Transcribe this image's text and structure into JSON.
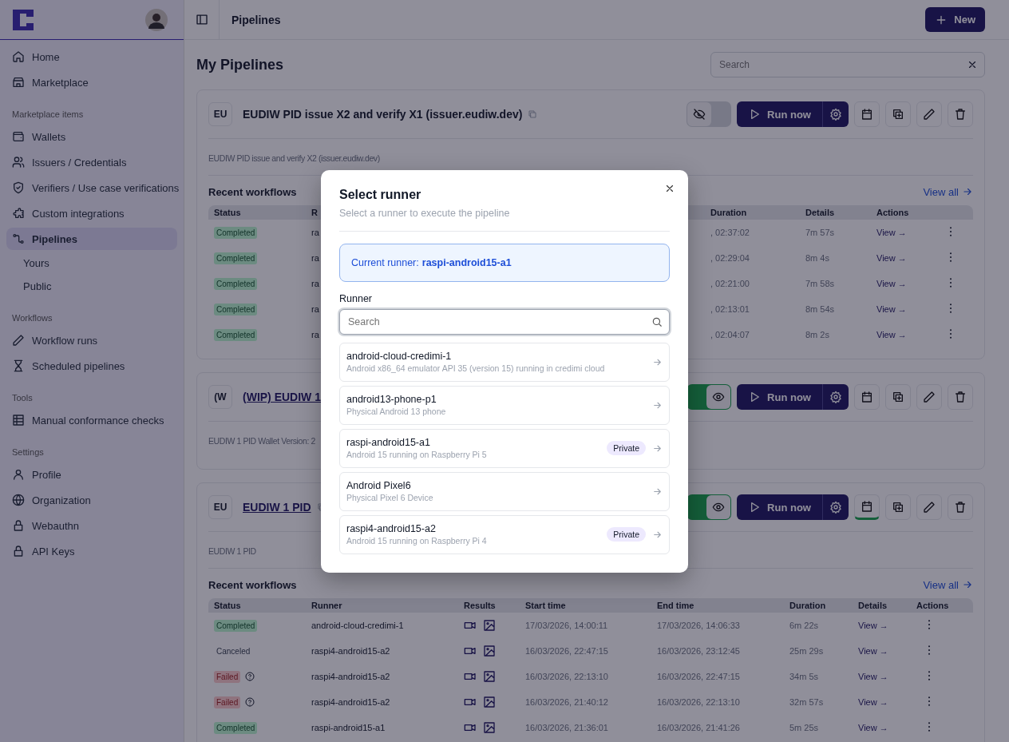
{
  "sidebar": {
    "groups": [
      {
        "items": [
          {
            "label": "Home",
            "selected": false
          },
          {
            "label": "Marketplace",
            "selected": false
          }
        ]
      },
      {
        "heading": "Marketplace items",
        "items": [
          {
            "label": "Wallets",
            "selected": false
          },
          {
            "label": "Issuers / Credentials",
            "selected": false
          },
          {
            "label": "Verifiers / Use case verifications",
            "selected": false
          },
          {
            "label": "Custom integrations",
            "selected": false
          },
          {
            "label": "Pipelines",
            "selected": true,
            "children": [
              {
                "label": "Yours",
                "selected": false
              },
              {
                "label": "Public",
                "selected": false
              }
            ]
          }
        ]
      },
      {
        "heading": "Workflows",
        "items": [
          {
            "label": "Workflow runs",
            "selected": false
          },
          {
            "label": "Scheduled pipelines",
            "selected": false
          }
        ]
      },
      {
        "heading": "Tools",
        "items": [
          {
            "label": "Manual conformance checks",
            "selected": false
          }
        ]
      },
      {
        "heading": "Settings",
        "items": [
          {
            "label": "Profile",
            "selected": false
          },
          {
            "label": "Organization",
            "selected": false
          },
          {
            "label": "Webauthn",
            "selected": false
          },
          {
            "label": "API Keys",
            "selected": false
          }
        ]
      }
    ]
  },
  "header": {
    "title": "Pipelines",
    "new_button": "New"
  },
  "page_title": "My Pipelines",
  "search": {
    "placeholder": "Search"
  },
  "pipelines": [
    {
      "badge": "EU",
      "title": "EUDIW PID issue X2 and verify X1 (issuer.eudiw.dev)",
      "link": false,
      "copy_icon": true,
      "public": false,
      "scheduled": false,
      "run_label": "Run now",
      "description": "EUDIW PID issue and verify X2 (issuer.eudiw.dev)",
      "workflows": {
        "heading": "Recent workflows",
        "view_all": "View all",
        "columns": {
          "status": "Status",
          "runner": "R",
          "duration": "Duration",
          "details": "Details",
          "actions": "Actions"
        },
        "rows": [
          {
            "status": "Completed",
            "kind": "completed",
            "runner": "ra",
            "end_time": ", 02:37:02",
            "duration": "7m 57s",
            "details": "View →"
          },
          {
            "status": "Completed",
            "kind": "completed",
            "runner": "ra",
            "end_time": ", 02:29:04",
            "duration": "8m 4s",
            "details": "View →"
          },
          {
            "status": "Completed",
            "kind": "completed",
            "runner": "ra",
            "end_time": ", 02:21:00",
            "duration": "7m 58s",
            "details": "View →"
          },
          {
            "status": "Completed",
            "kind": "completed",
            "runner": "ra",
            "end_time": ", 02:13:01",
            "duration": "8m 54s",
            "details": "View →"
          },
          {
            "status": "Completed",
            "kind": "completed",
            "runner": "ra",
            "end_time": ", 02:04:07",
            "duration": "8m 2s",
            "details": "View →"
          }
        ]
      }
    },
    {
      "badge": "(W",
      "title": "(WIP) EUDIW 1",
      "link": true,
      "copy_icon": false,
      "public": true,
      "scheduled": false,
      "run_label": "Run now",
      "description": "EUDIW 1 PID Wallet Version: 2"
    },
    {
      "badge": "EU",
      "title": "EUDIW 1 PID",
      "link": true,
      "copy_icon": true,
      "public": true,
      "scheduled": true,
      "run_label": "Run now",
      "description": "EUDIW 1 PID",
      "workflows": {
        "heading": "Recent workflows",
        "view_all": "View all",
        "columns": {
          "status": "Status",
          "runner": "Runner",
          "results": "Results",
          "start_time": "Start time",
          "end_time": "End time",
          "duration": "Duration",
          "details": "Details",
          "actions": "Actions"
        },
        "rows": [
          {
            "status": "Completed",
            "kind": "completed",
            "runner": "android-cloud-credimi-1",
            "start_time": "17/03/2026, 14:00:11",
            "end_time": "17/03/2026, 14:06:33",
            "duration": "6m 22s",
            "details": "View →"
          },
          {
            "status": "Canceled",
            "kind": "canceled",
            "runner": "raspi4-android15-a2",
            "start_time": "16/03/2026, 22:47:15",
            "end_time": "16/03/2026, 23:12:45",
            "duration": "25m 29s",
            "details": "View →"
          },
          {
            "status": "Failed",
            "kind": "failed",
            "runner": "raspi4-android15-a2",
            "start_time": "16/03/2026, 22:13:10",
            "end_time": "16/03/2026, 22:47:15",
            "duration": "34m 5s",
            "details": "View →"
          },
          {
            "status": "Failed",
            "kind": "failed",
            "runner": "raspi4-android15-a2",
            "start_time": "16/03/2026, 21:40:12",
            "end_time": "16/03/2026, 22:13:10",
            "duration": "32m 57s",
            "details": "View →"
          },
          {
            "status": "Completed",
            "kind": "completed",
            "runner": "raspi-android15-a1",
            "start_time": "16/03/2026, 21:36:01",
            "end_time": "16/03/2026, 21:41:26",
            "duration": "5m 25s",
            "details": "View →"
          }
        ]
      }
    }
  ],
  "modal": {
    "title": "Select runner",
    "subtitle": "Select a runner to execute the pipeline",
    "current_label": "Current runner:",
    "current_runner": "raspi-android15-a1",
    "field_label": "Runner",
    "search_placeholder": "Search",
    "runners": [
      {
        "name": "android-cloud-credimi-1",
        "description": "Android x86_64 emulator API 35 (version 15) running in credimi cloud"
      },
      {
        "name": "android13-phone-p1",
        "description": "Physical Android 13 phone"
      },
      {
        "name": "raspi-android15-a1",
        "description": "Android 15 running on Raspberry Pi 5",
        "badge": "Private"
      },
      {
        "name": "Android Pixel6",
        "description": "Physical Pixel 6 Device"
      },
      {
        "name": "raspi4-android15-a2",
        "description": "Android 15 running on Raspberry Pi 4",
        "badge": "Private"
      }
    ]
  }
}
